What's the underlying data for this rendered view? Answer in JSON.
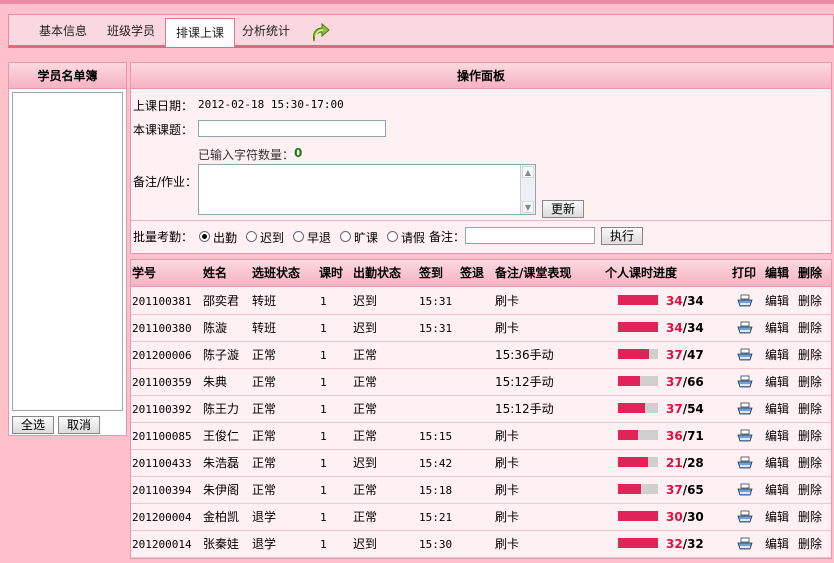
{
  "tabs": [
    {
      "label": "基本信息",
      "active": false
    },
    {
      "label": "班级学员",
      "active": false
    },
    {
      "label": "排课上课",
      "active": true
    },
    {
      "label": "分析统计",
      "active": false
    }
  ],
  "roster": {
    "title": "学员名单簿",
    "select_all": "全选",
    "cancel": "取消"
  },
  "panel": {
    "title": "操作面板",
    "date_label": "上课日期：",
    "date_value": "2012-02-18 15:30-17:00",
    "topic_label": "本课课题：",
    "topic_value": "",
    "char_count_label": "已输入字符数量：",
    "char_count": "0",
    "note_label": "备注/作业：",
    "note_value": "",
    "update_button": "更新",
    "batch_label": "批量考勤：",
    "attendance_options": [
      {
        "label": "出勤",
        "selected": true
      },
      {
        "label": "迟到",
        "selected": false
      },
      {
        "label": "早退",
        "selected": false
      },
      {
        "label": "旷课",
        "selected": false
      },
      {
        "label": "请假",
        "selected": false
      }
    ],
    "remark_label": "备注：",
    "remark_value": "",
    "execute_button": "执行"
  },
  "table": {
    "columns": [
      "学号",
      "姓名",
      "选班状态",
      "课时",
      "出勤状态",
      "签到",
      "签退",
      "备注/课堂表现",
      "个人课时进度",
      "打印",
      "编辑",
      "删除"
    ],
    "edit_label": "编辑",
    "delete_label": "删除",
    "rows": [
      {
        "id": "201100381",
        "name": "邵奕君",
        "status": "转班",
        "hours": "1",
        "attendance": "迟到",
        "signin": "15:31",
        "signout": "",
        "remark": "刷卡",
        "done": 34,
        "total": 34,
        "done_text": "34",
        "total_text": "/34"
      },
      {
        "id": "201100380",
        "name": "陈漩",
        "status": "转班",
        "hours": "1",
        "attendance": "迟到",
        "signin": "15:31",
        "signout": "",
        "remark": "刷卡",
        "done": 34,
        "total": 34,
        "done_text": "34",
        "total_text": "/34"
      },
      {
        "id": "201200006",
        "name": "陈子漩",
        "status": "正常",
        "hours": "1",
        "attendance": "正常",
        "signin": "",
        "signout": "",
        "remark": "15:36手动",
        "done": 37,
        "total": 47,
        "done_text": "37",
        "total_text": "/47"
      },
      {
        "id": "201100359",
        "name": "朱典",
        "status": "正常",
        "hours": "1",
        "attendance": "正常",
        "signin": "",
        "signout": "",
        "remark": "15:12手动",
        "done": 37,
        "total": 66,
        "done_text": "37",
        "total_text": "/66"
      },
      {
        "id": "201100392",
        "name": "陈王力",
        "status": "正常",
        "hours": "1",
        "attendance": "正常",
        "signin": "",
        "signout": "",
        "remark": "15:12手动",
        "done": 37,
        "total": 54,
        "done_text": "37",
        "total_text": "/54"
      },
      {
        "id": "201100085",
        "name": "王俊仁",
        "status": "正常",
        "hours": "1",
        "attendance": "正常",
        "signin": "15:15",
        "signout": "",
        "remark": "刷卡",
        "done": 36,
        "total": 71,
        "done_text": "36",
        "total_text": "/71"
      },
      {
        "id": "201100433",
        "name": "朱浩磊",
        "status": "正常",
        "hours": "1",
        "attendance": "迟到",
        "signin": "15:42",
        "signout": "",
        "remark": "刷卡",
        "done": 21,
        "total": 28,
        "done_text": "21",
        "total_text": "/28"
      },
      {
        "id": "201100394",
        "name": "朱伊阁",
        "status": "正常",
        "hours": "1",
        "attendance": "正常",
        "signin": "15:18",
        "signout": "",
        "remark": "刷卡",
        "done": 37,
        "total": 65,
        "done_text": "37",
        "total_text": "/65"
      },
      {
        "id": "201200004",
        "name": "金柏凯",
        "status": "退学",
        "hours": "1",
        "attendance": "正常",
        "signin": "15:21",
        "signout": "",
        "remark": "刷卡",
        "done": 30,
        "total": 30,
        "done_text": "30",
        "total_text": "/30"
      },
      {
        "id": "201200014",
        "name": "张秦娃",
        "status": "退学",
        "hours": "1",
        "attendance": "迟到",
        "signin": "15:30",
        "signout": "",
        "remark": "刷卡",
        "done": 32,
        "total": 32,
        "done_text": "32",
        "total_text": "/32"
      }
    ]
  },
  "colors": {
    "background": "#ffc0cc",
    "progress_fill": "#e0245a",
    "progress_track": "#cfcfcf",
    "progress_text": "#e01040"
  }
}
